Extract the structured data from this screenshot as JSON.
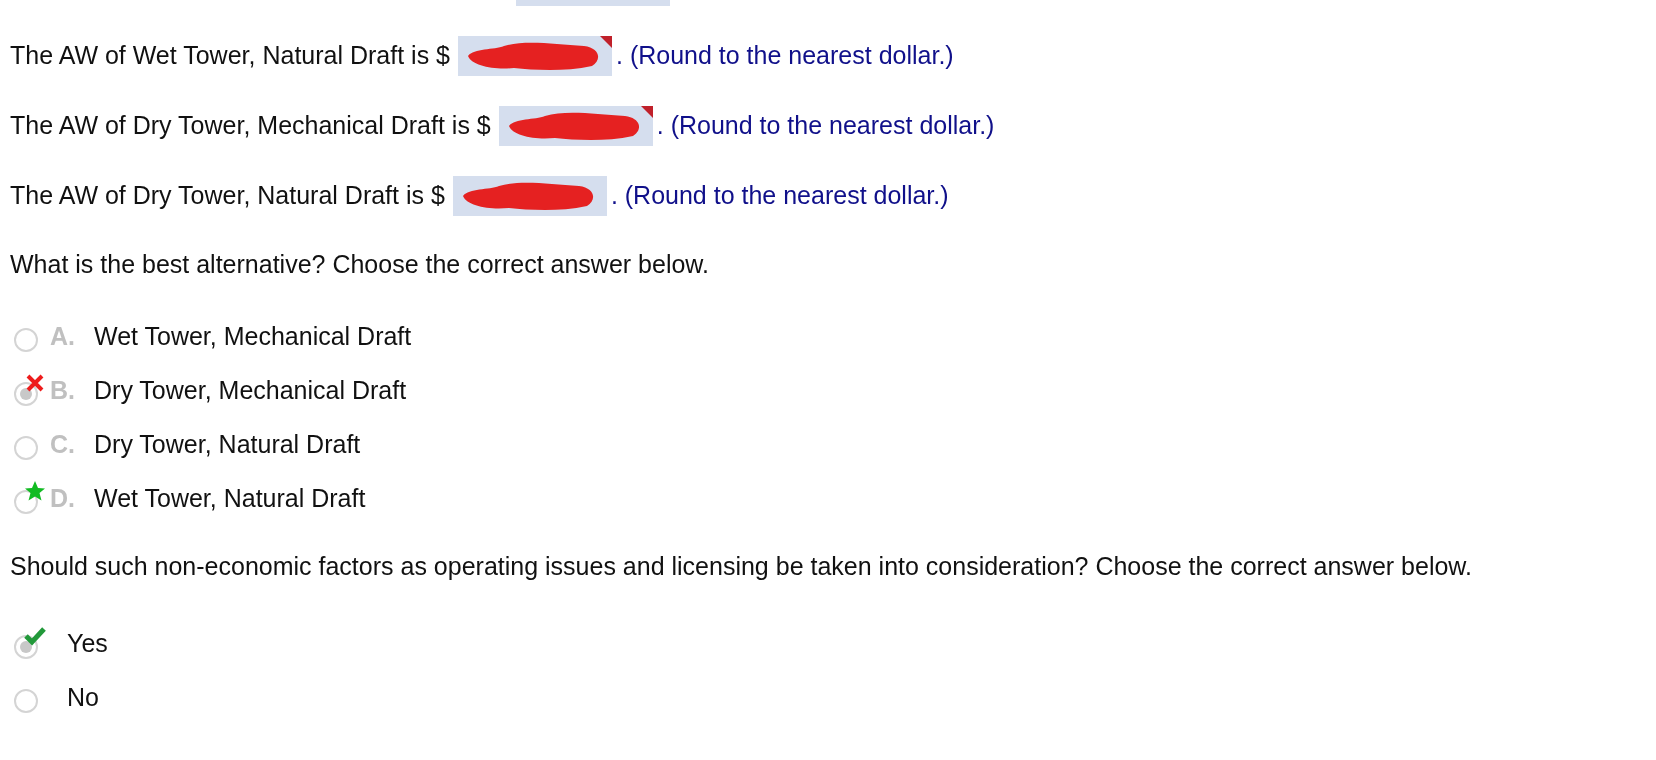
{
  "answers": [
    {
      "label": "The AW of Wet Tower, Natural Draft is $",
      "flagged": true,
      "redacted": true,
      "hint": ". (Round to the nearest dollar.)"
    },
    {
      "label": "The AW of Dry Tower, Mechanical Draft is $",
      "flagged": true,
      "redacted": true,
      "hint": ". (Round to the nearest dollar.)"
    },
    {
      "label": "The AW of Dry Tower, Natural Draft is $",
      "flagged": false,
      "redacted": true,
      "hint": ". (Round to the nearest dollar.)"
    }
  ],
  "questions": [
    {
      "prompt": "What is the best alternative? Choose the correct answer below.",
      "options": [
        {
          "letter": "A.",
          "text": "Wet Tower, Mechanical Draft",
          "selected": false,
          "kind": "plain"
        },
        {
          "letter": "B.",
          "text": "Dry Tower, Mechanical Draft",
          "selected": true,
          "kind": "wrong"
        },
        {
          "letter": "C.",
          "text": "Dry Tower, Natural Draft",
          "selected": false,
          "kind": "plain"
        },
        {
          "letter": "D.",
          "text": "Wet Tower, Natural Draft",
          "selected": false,
          "kind": "answer"
        }
      ]
    },
    {
      "prompt": "Should such non-economic factors as operating issues and licensing be taken into consideration? Choose the correct answer below.",
      "options": [
        {
          "text": "Yes",
          "selected": true,
          "kind": "correct"
        },
        {
          "text": "No",
          "selected": false,
          "kind": "plain"
        }
      ]
    }
  ]
}
